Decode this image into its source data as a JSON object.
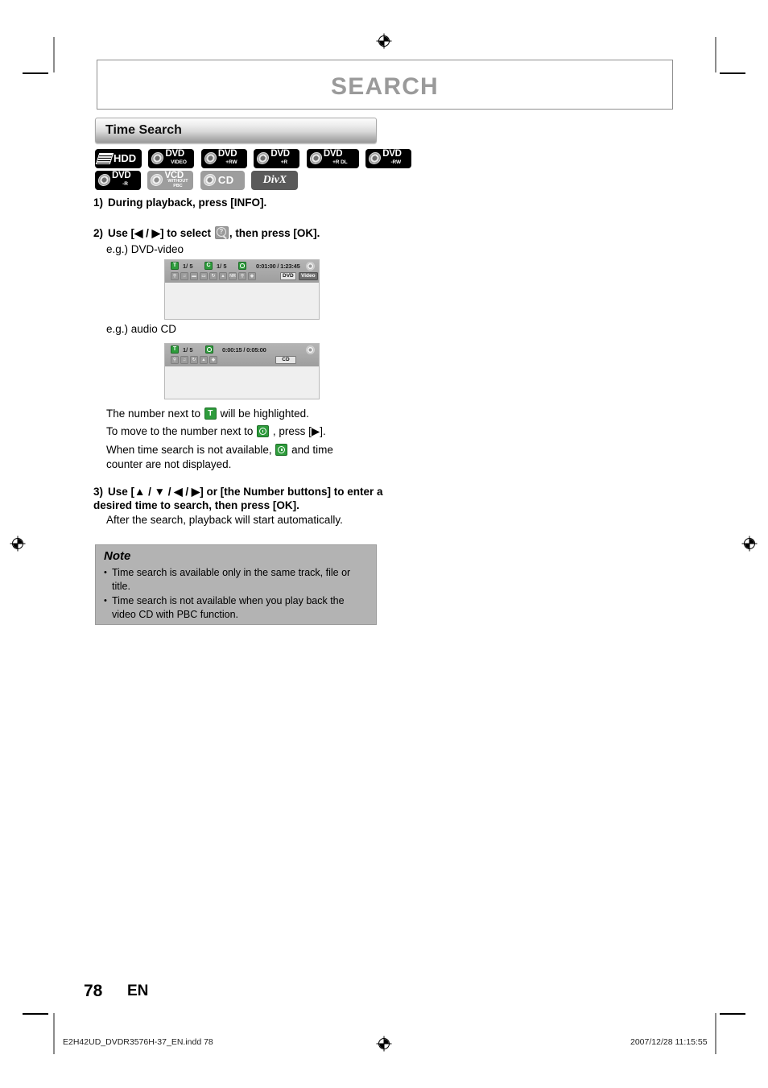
{
  "header": {
    "title": "SEARCH"
  },
  "section": {
    "title": "Time Search"
  },
  "media_icons": [
    {
      "name": "HDD",
      "label": "HDD",
      "sub": "",
      "style": "black",
      "kind": "hdd"
    },
    {
      "name": "DVD-Video",
      "label": "DVD",
      "sub": "VIDEO",
      "style": "black",
      "kind": "disc"
    },
    {
      "name": "DVD+RW",
      "label": "DVD",
      "sub": "+RW",
      "style": "black",
      "kind": "disc"
    },
    {
      "name": "DVD+R",
      "label": "DVD",
      "sub": "+R",
      "style": "black",
      "kind": "disc"
    },
    {
      "name": "DVD+R DL",
      "label": "DVD",
      "sub": "+R DL",
      "style": "black",
      "kind": "disc"
    },
    {
      "name": "DVD-RW",
      "label": "DVD",
      "sub": "-RW",
      "style": "black",
      "kind": "disc"
    },
    {
      "name": "DVD-R",
      "label": "DVD",
      "sub": "-R",
      "style": "black",
      "kind": "disc"
    },
    {
      "name": "VCD",
      "label": "VCD",
      "sub": "WITHOUT PBC",
      "style": "gray",
      "kind": "disc"
    },
    {
      "name": "CD",
      "label": "CD",
      "sub": "",
      "style": "gray",
      "kind": "cd"
    },
    {
      "name": "DivX",
      "label": "DivX",
      "sub": "",
      "style": "dgray",
      "kind": "divx"
    }
  ],
  "steps": {
    "step1": {
      "num": "1)",
      "text": "During playback, press [INFO]."
    },
    "step2": {
      "num": "2)",
      "text_before": "Use [◀ / ▶] to select",
      "text_after": ", then press [OK]."
    },
    "step3": {
      "num": "3)",
      "line1": "Use [▲ / ▼ / ◀ / ▶] or [the Number buttons] to",
      "line2": "enter a desired time to search, then press [OK].",
      "sub": "After the search, playback will start automatically."
    }
  },
  "examples": {
    "dvd_label": "e.g.) DVD-video",
    "cd_label": "e.g.) audio CD",
    "dvd_osd": {
      "title_badge": "T",
      "title_counter": "1/ 5",
      "chapter_badge": "C",
      "chapter_counter": "1/ 5",
      "time": "0:01:00 / 1:23:45",
      "icons": [
        "search-icon",
        "audio-icon",
        "subtitle-icon",
        "angle-icon",
        "repeat-icon",
        "surround-icon",
        "NR",
        "zoom-icon",
        "picture-icon"
      ],
      "tag_left": "DVD",
      "tag_right": "Video"
    },
    "cd_osd": {
      "title_badge": "T",
      "title_counter": "1/ 5",
      "time": "0:00:15 / 0:05:00",
      "icons": [
        "search-icon",
        "audio-icon",
        "repeat-icon",
        "surround-icon",
        "picture-icon"
      ],
      "tag": "CD"
    }
  },
  "notes_inline": {
    "line1_before": "The number next to",
    "line1_after": "will be highlighted.",
    "line2_before": "To move to the number next to",
    "line2_after": ", press [▶].",
    "line3_before": "When time search is not available,",
    "line3_after": "and time",
    "line3_cont": "counter are not displayed."
  },
  "note": {
    "title": "Note",
    "items": [
      "Time search is available only in the same track, file or title.",
      "Time search is not available when you play back the video CD with PBC function."
    ]
  },
  "footer": {
    "page_number": "78",
    "language": "EN",
    "file_name": "E2H42UD_DVDR3576H-37_EN.indd   78",
    "timestamp": "2007/12/28   11:15:55"
  }
}
